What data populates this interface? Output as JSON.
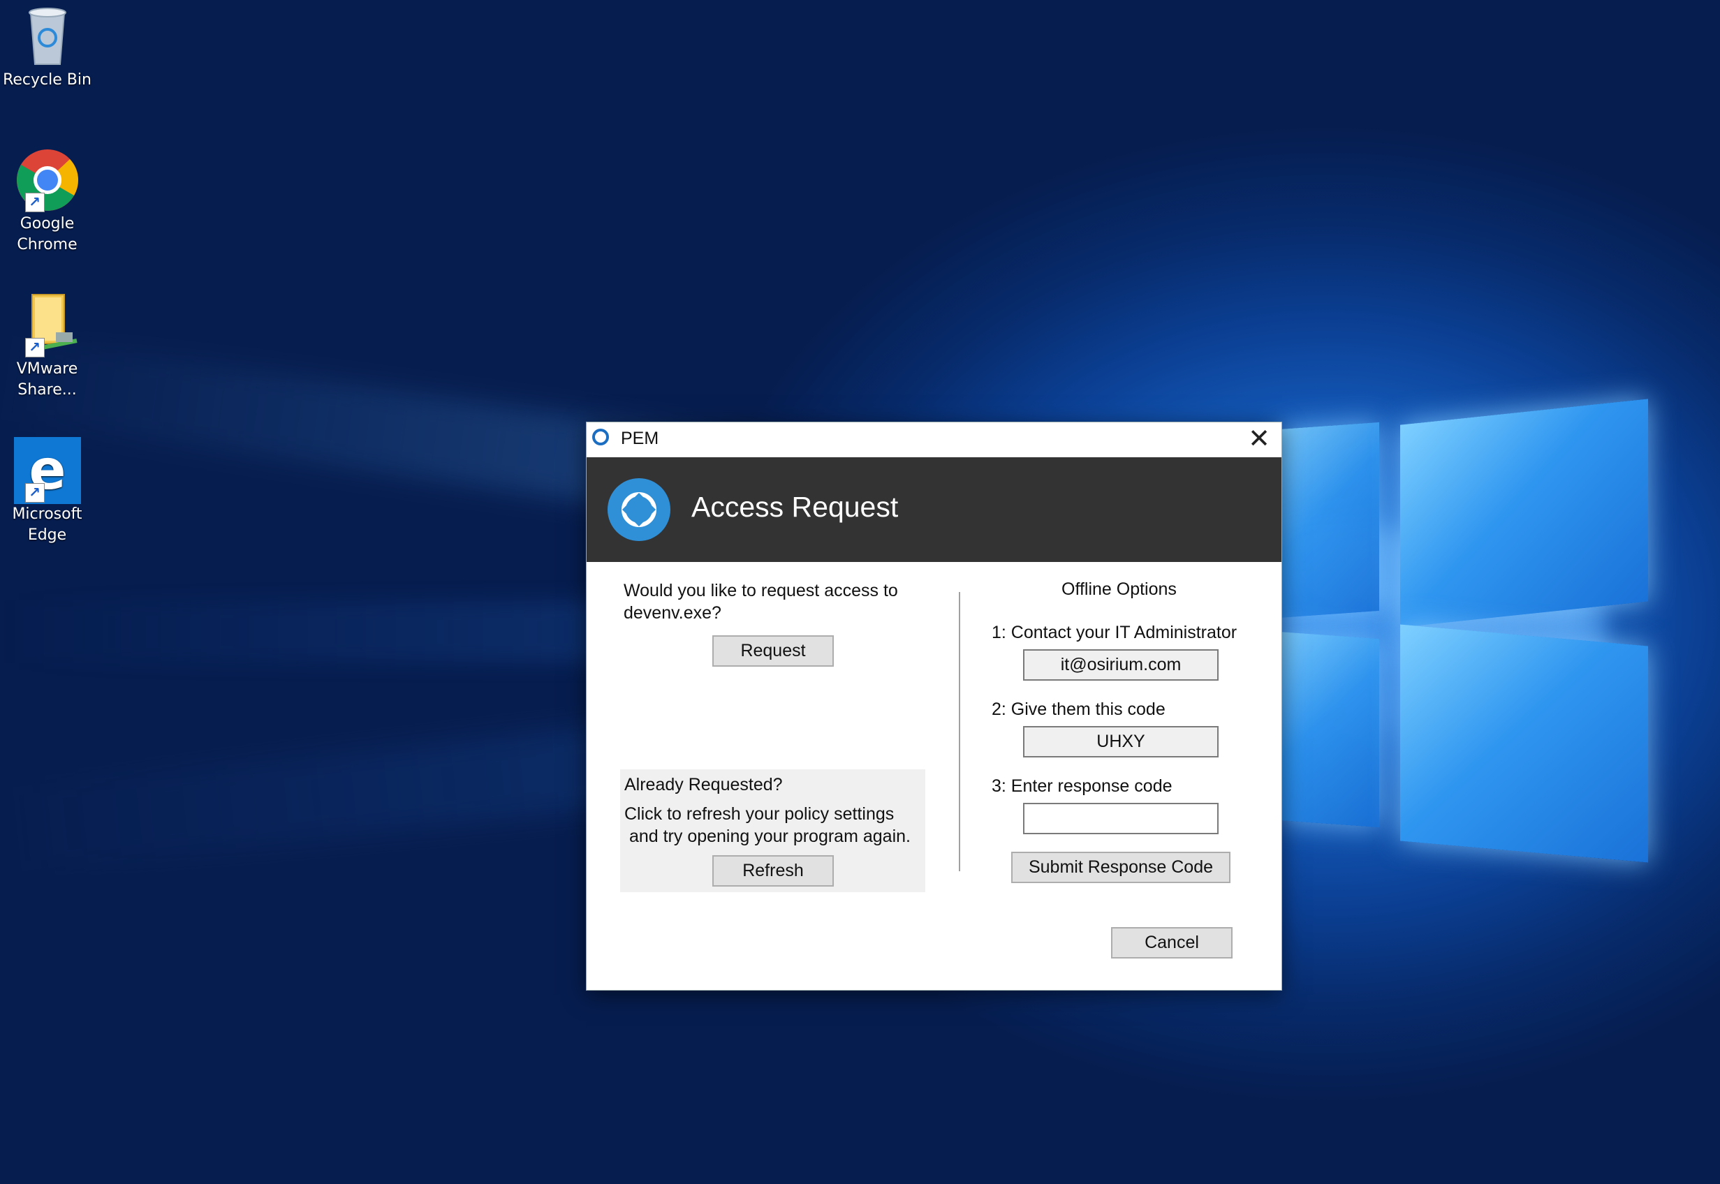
{
  "desktop": {
    "icons": [
      {
        "label": "Recycle Bin"
      },
      {
        "label": "Google\nChrome",
        "line1": "Google",
        "line2": "Chrome"
      },
      {
        "label": "VMware Share...",
        "line1": "VMware",
        "line2": "Share..."
      },
      {
        "label": "Microsoft Edge",
        "line1": "Microsoft",
        "line2": "Edge"
      }
    ]
  },
  "dialog": {
    "window_title": "PEM",
    "header_title": "Access Request",
    "request_prompt_line1": "Would you like to request access to",
    "request_prompt_line2": "devenv.exe?",
    "request_button": "Request",
    "already_requested": "Already Requested?",
    "refresh_hint_line1": "Click to refresh your policy settings",
    "refresh_hint_line2": " and try opening your program again.",
    "refresh_button": "Refresh",
    "offline_title": "Offline Options",
    "step1_label": "1: Contact your IT Administrator",
    "admin_email": "it@osirium.com",
    "step2_label": "2: Give them this code",
    "request_code": "UHXY",
    "step3_label": "3: Enter response code",
    "response_code_value": "",
    "submit_button": "Submit Response Code",
    "cancel_button": "Cancel"
  },
  "colors": {
    "header_bg": "#333333",
    "accent_blue": "#2f90d8",
    "button_bg": "#e1e1e1"
  }
}
